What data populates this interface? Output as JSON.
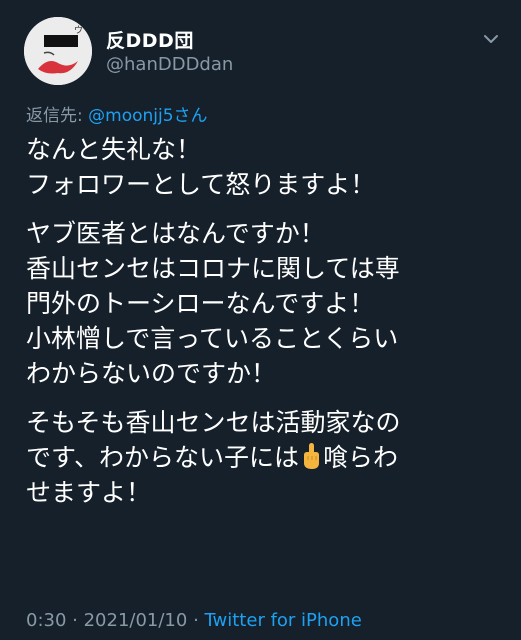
{
  "author": {
    "display_name": "反DDD団",
    "handle": "@hanDDDdan"
  },
  "reply": {
    "prefix": "返信先: ",
    "mention": "@moonjj5さん"
  },
  "tweet": {
    "p1": [
      "なんと失礼な！",
      "フォロワーとして怒りますよ！"
    ],
    "p2": [
      "ヤブ医者とはなんですか！",
      "香山センセはコロナに関しては専",
      "門外のトーシローなんですよ！",
      "小林憎しで言っていることくらい",
      "わからないのですか！"
    ],
    "p3_line1": "そもそも香山センセは活動家なの",
    "p3_line2_a": "です、わからない子には",
    "p3_line2_b": "喰らわ",
    "p3_line3": "せますよ！"
  },
  "meta": {
    "time": "0:30",
    "sep1": " · ",
    "date": "2021/01/10",
    "sep2": " · ",
    "source": "Twitter for iPhone"
  },
  "icons": {
    "chevron": "chevron-down-icon",
    "emoji": "middle-finger-emoji"
  },
  "colors": {
    "background": "#15202b",
    "text": "#ffffff",
    "secondary": "#8899a6",
    "link": "#1da1f2"
  }
}
